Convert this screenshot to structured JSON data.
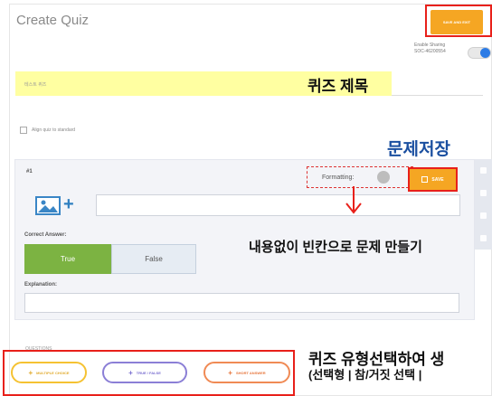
{
  "header": {
    "title": "Create Quiz",
    "save_exit_label": "SAVE AND EXIT",
    "sharing_label": "Enable Sharing",
    "sharing_code": "SOC-46200554",
    "sharing_enabled": true
  },
  "quiz_title": {
    "field_text": "테스트 퀴즈",
    "annotation": "퀴즈 제목"
  },
  "align": {
    "label": "Align quiz to standard"
  },
  "question": {
    "number": "#1",
    "save_annotation": "문제저장",
    "formatting_label": "Formatting:",
    "save_label": "SAVE",
    "content_annotation": "내용없이 빈칸으로 문제 만들기",
    "correct_answer_label": "Correct Answer:",
    "true_label": "True",
    "false_label": "False",
    "explanation_label": "Explanation:",
    "selected_answer": "True"
  },
  "question_types": {
    "section_label": "QUESTIONS",
    "multiple_choice": "MULTIPLE CHOICE",
    "true_false": "TRUE / FALSE",
    "short_answer": "SHORT ANSWER",
    "annotation_line1": "퀴즈 유형선택하여 생",
    "annotation_line2": "(선택형 | 참/거짓 선택 |"
  },
  "colors": {
    "accent_orange": "#f5a623",
    "highlight_red": "#e8201a",
    "true_green": "#7cb342",
    "title_highlight": "#ffffa1",
    "annotation_blue": "#1a4fa0"
  }
}
